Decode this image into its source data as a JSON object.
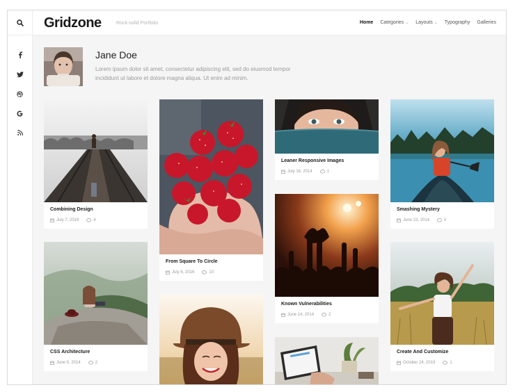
{
  "header": {
    "logo": "Gridzone",
    "tagline": "Rock-solid Portfolio",
    "nav": [
      {
        "label": "Home",
        "active": true,
        "dropdown": false
      },
      {
        "label": "Categories",
        "active": false,
        "dropdown": true
      },
      {
        "label": "Layouts",
        "active": false,
        "dropdown": true
      },
      {
        "label": "Typography",
        "active": false,
        "dropdown": false
      },
      {
        "label": "Galleries",
        "active": false,
        "dropdown": false
      }
    ],
    "caret": "⌄"
  },
  "sidebar": {
    "icons": [
      "search-icon",
      "facebook-icon",
      "twitter-icon",
      "dribbble-icon",
      "google-icon",
      "rss-icon"
    ]
  },
  "author": {
    "name": "Jane Doe",
    "bio": "Lorem ipsum dolor sit amet, consectetur adipiscing elit, sed do eiusmod tempor incididunt ut labore et dolore magna aliqua. Ut enim ad minim."
  },
  "posts": [
    {
      "title": "Combining Design",
      "date": "July 7, 2019",
      "comments": "4"
    },
    {
      "title": "CSS Architecture",
      "date": "June 5, 2014",
      "comments": "2"
    },
    {
      "title": "From Square To Circle",
      "date": "July 6, 2016",
      "comments": "10"
    },
    {
      "title": "Leaner Responsive Images",
      "date": "July 16, 2014",
      "comments": "1"
    },
    {
      "title": "Known Vulnerabilities",
      "date": "June 14, 2014",
      "comments": "2"
    },
    {
      "title": "Smashing Mystery",
      "date": "June 23, 2014",
      "comments": "0"
    },
    {
      "title": "Create And Customize",
      "date": "October 24, 2019",
      "comments": "1"
    }
  ],
  "colors": {
    "background": "#f5f5f5",
    "card": "#ffffff",
    "meta_text": "#9a9a9a",
    "title_text": "#1a1a1a"
  }
}
